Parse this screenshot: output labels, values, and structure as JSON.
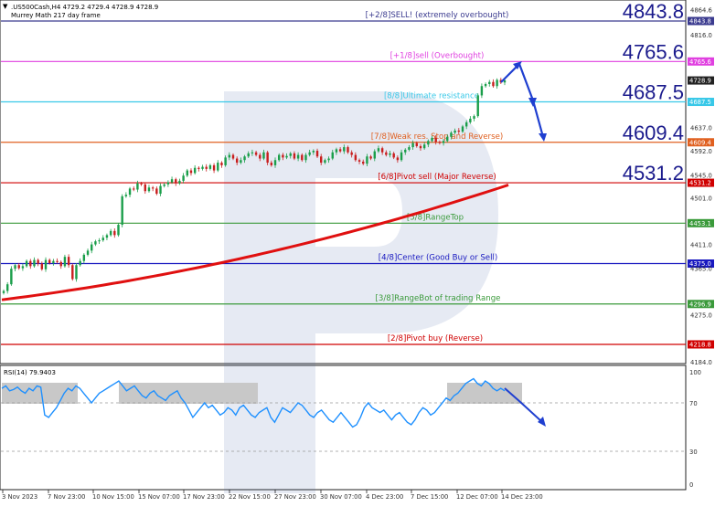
{
  "header": {
    "symbol_line": ".US500Cash,H4  4729.2 4729.4 4728.9 4728.9",
    "indicator_line": "Murrey Math 217 day frame"
  },
  "chart_data": [
    {
      "type": "candlestick",
      "title": ".US500Cash,H4",
      "ylim": [
        4150,
        4880
      ],
      "price_axis_ticks": [
        "4864.6",
        "4843.8",
        "4816.0",
        "4765.6",
        "4728.9",
        "4687.5",
        "4637.0",
        "4609.4",
        "4592.0",
        "4545.0",
        "4531.2",
        "4501.0",
        "4453.1",
        "4411.0",
        "4375.0",
        "4365.0",
        "4296.9",
        "4275.0",
        "4218.8",
        "4184.0"
      ],
      "x_tick_labels": [
        "3 Nov 2023",
        "7 Nov 23:00",
        "10 Nov 15:00",
        "15 Nov 07:00",
        "17 Nov 23:00",
        "22 Nov 15:00",
        "27 Nov 23:00",
        "30 Nov 07:00",
        "4 Dec 23:00",
        "7 Dec 15:00",
        "12 Dec 07:00",
        "14 Dec 23:00"
      ],
      "close_series": [
        4322,
        4335,
        4365,
        4372,
        4366,
        4370,
        4380,
        4370,
        4382,
        4375,
        4364,
        4382,
        4376,
        4380,
        4378,
        4370,
        4388,
        4372,
        4345,
        4372,
        4380,
        4392,
        4400,
        4412,
        4418,
        4420,
        4425,
        4430,
        4438,
        4430,
        4450,
        4505,
        4508,
        4520,
        4518,
        4530,
        4528,
        4515,
        4522,
        4520,
        4510,
        4525,
        4528,
        4532,
        4538,
        4530,
        4535,
        4545,
        4555,
        4550,
        4560,
        4558,
        4562,
        4558,
        4565,
        4555,
        4570,
        4565,
        4580,
        4585,
        4578,
        4570,
        4575,
        4582,
        4588,
        4590,
        4585,
        4578,
        4590,
        4570,
        4565,
        4575,
        4585,
        4580,
        4583,
        4588,
        4578,
        4585,
        4575,
        4585,
        4590,
        4593,
        4582,
        4570,
        4575,
        4578,
        4590,
        4596,
        4592,
        4600,
        4590,
        4585,
        4575,
        4572,
        4568,
        4582,
        4578,
        4592,
        4598,
        4590,
        4585,
        4588,
        4580,
        4575,
        4590,
        4595,
        4600,
        4608,
        4602,
        4598,
        4605,
        4612,
        4618,
        4610,
        4608,
        4612,
        4620,
        4628,
        4632,
        4630,
        4640,
        4648,
        4655,
        4660,
        4700,
        4718,
        4722,
        4726,
        4718,
        4730,
        4725,
        4729
      ],
      "murrey_levels": [
        {
          "name": "[+2/8]SELL! (extremely overbought)",
          "value": 4843.8,
          "color": "#3b3b8f"
        },
        {
          "name": "[+1/8]sell (Overbought)",
          "value": 4765.6,
          "color": "#e040e0"
        },
        {
          "name": "[8/8]Ultimate resistance",
          "value": 4687.5,
          "color": "#38c8e8"
        },
        {
          "name": "[7/8]Weak res. Stop and Reverse)",
          "value": 4609.4,
          "color": "#e06020"
        },
        {
          "name": "[6/8]Pivot sell (Major Reverse)",
          "value": 4531.2,
          "color": "#d00000"
        },
        {
          "name": "[5/8]RangeTop",
          "value": 4453.1,
          "color": "#3a9a3a"
        },
        {
          "name": "[4/8]Center (Good Buy or Sell)",
          "value": 4375.0,
          "color": "#1818c0"
        },
        {
          "name": "[3/8]RangeBot of trading Range",
          "value": 4296.9,
          "color": "#3a9a3a"
        },
        {
          "name": "[2/8]Pivot buy (Reverse)",
          "value": 4218.8,
          "color": "#d00000"
        }
      ],
      "big_price_labels": [
        "4843.8",
        "4765.6",
        "4687.5",
        "4609.4",
        "4531.2"
      ],
      "moving_average": {
        "name": "217 day frame",
        "color": "#e01010",
        "start": 4305,
        "end": 4527
      },
      "current_price": "4728.9"
    },
    {
      "type": "line",
      "title": "RSI(14) 79.9403",
      "ylim": [
        0,
        100
      ],
      "levels": [
        30,
        70
      ],
      "y_ticks": [
        "100",
        "70",
        "30",
        "0"
      ],
      "values": [
        82,
        84,
        80,
        81,
        83,
        80,
        78,
        82,
        80,
        84,
        83,
        60,
        58,
        62,
        66,
        72,
        78,
        82,
        80,
        84,
        82,
        78,
        74,
        70,
        74,
        78,
        80,
        82,
        84,
        86,
        88,
        84,
        80,
        82,
        84,
        80,
        76,
        74,
        78,
        80,
        76,
        74,
        72,
        76,
        78,
        80,
        74,
        70,
        64,
        58,
        62,
        66,
        70,
        66,
        68,
        64,
        60,
        62,
        66,
        64,
        60,
        66,
        68,
        64,
        60,
        58,
        62,
        64,
        66,
        58,
        54,
        60,
        66,
        64,
        62,
        66,
        70,
        68,
        64,
        60,
        58,
        62,
        64,
        60,
        56,
        54,
        58,
        62,
        58,
        54,
        50,
        52,
        58,
        66,
        70,
        66,
        64,
        62,
        64,
        60,
        56,
        60,
        62,
        58,
        54,
        52,
        56,
        62,
        66,
        64,
        60,
        62,
        66,
        70,
        74,
        72,
        76,
        78,
        82,
        86,
        88,
        90,
        86,
        84,
        88,
        86,
        82,
        80,
        82,
        80
      ]
    }
  ]
}
